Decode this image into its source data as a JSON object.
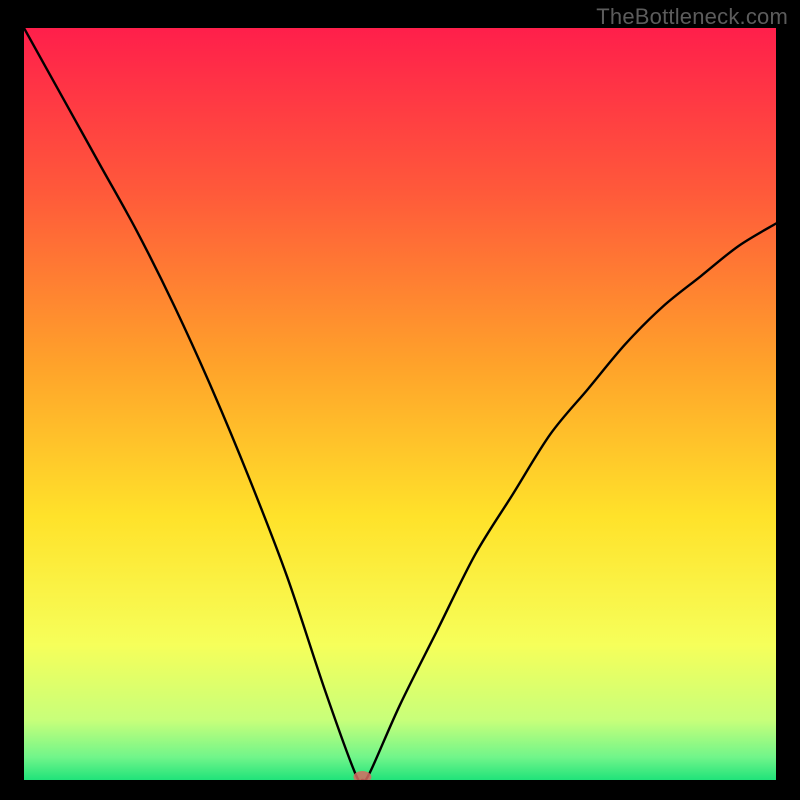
{
  "watermark": "TheBottleneck.com",
  "chart_data": {
    "type": "line",
    "title": "",
    "xlabel": "",
    "ylabel": "",
    "xlim": [
      0,
      100
    ],
    "ylim": [
      0,
      100
    ],
    "x": [
      0,
      5,
      10,
      15,
      20,
      25,
      30,
      35,
      40,
      44,
      45,
      46,
      50,
      55,
      60,
      65,
      70,
      75,
      80,
      85,
      90,
      95,
      100
    ],
    "values": [
      100,
      91,
      82,
      73,
      63,
      52,
      40,
      27,
      12,
      1,
      0,
      1,
      10,
      20,
      30,
      38,
      46,
      52,
      58,
      63,
      67,
      71,
      74
    ],
    "minimum_x": 45,
    "minimum_y": 0,
    "marker": {
      "x": 45,
      "y": 0,
      "label": "optimal-point"
    },
    "background_gradient": {
      "stops": [
        {
          "offset": 0.0,
          "color": "#ff1f4b"
        },
        {
          "offset": 0.22,
          "color": "#ff5a3a"
        },
        {
          "offset": 0.45,
          "color": "#ffa32a"
        },
        {
          "offset": 0.65,
          "color": "#ffe22a"
        },
        {
          "offset": 0.82,
          "color": "#f6ff5a"
        },
        {
          "offset": 0.92,
          "color": "#c8ff7a"
        },
        {
          "offset": 0.97,
          "color": "#70f58a"
        },
        {
          "offset": 1.0,
          "color": "#20e37a"
        }
      ]
    }
  }
}
